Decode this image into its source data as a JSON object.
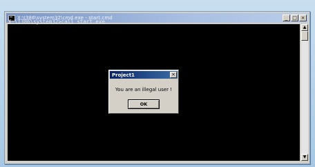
{
  "window": {
    "title": "X:\\I386\\system32\\cmd.exe - start.cmd",
    "minimize_label": "_",
    "maximize_label": "□",
    "close_label": "×"
  },
  "console": {
    "lines": [
      "X:\\I386\\system32>call start.exe"
    ]
  },
  "scrollbar": {
    "up_arrow": "▲",
    "down_arrow": "▼"
  },
  "dialog": {
    "title": "Project1",
    "close_label": "×",
    "message": "You are an illegal user !",
    "ok_label": "OK"
  },
  "colors": {
    "console_bg": "#000000",
    "console_text": "#e8e8e8",
    "dialog_titlebar": "#0a246a"
  }
}
